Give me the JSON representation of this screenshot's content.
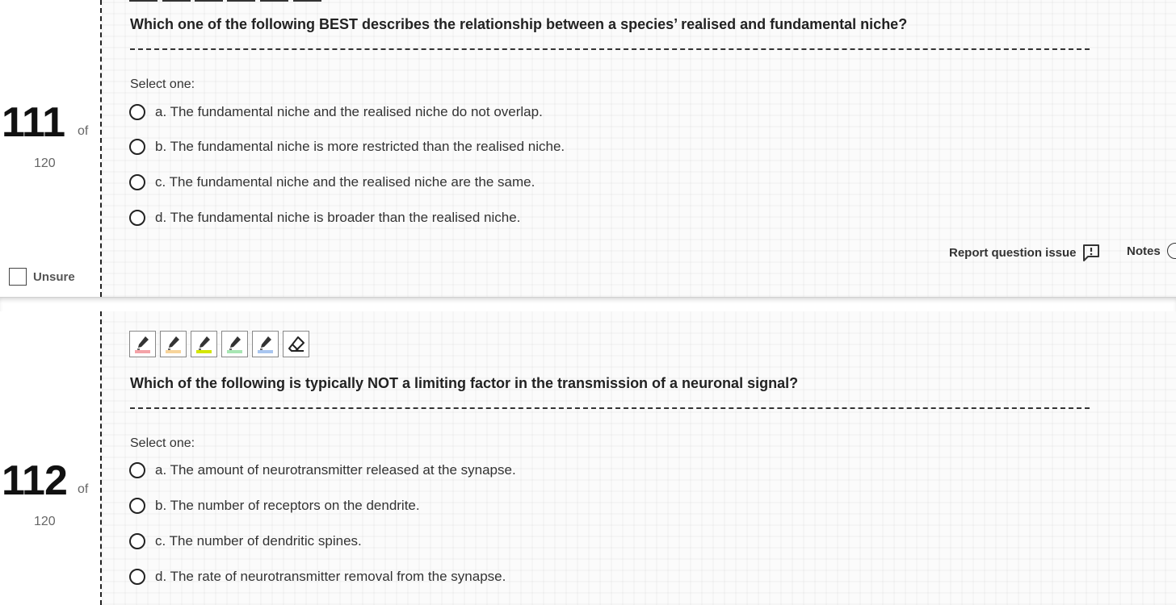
{
  "questions": [
    {
      "number": "111",
      "of_label": "of",
      "total": "120",
      "question": "Which one of the following BEST describes the relationship between a species’ realised and fundamental niche?",
      "select_label": "Select one:",
      "options": [
        "a. The fundamental niche and the realised niche do not overlap.",
        "b. The fundamental niche is more restricted than the realised niche.",
        "c. The fundamental niche and the realised niche are the same.",
        "d. The fundamental niche is broader than the realised niche."
      ],
      "unsure_label": "Unsure",
      "report_label": "Report question issue",
      "notes_label": "Notes"
    },
    {
      "number": "112",
      "of_label": "of",
      "total": "120",
      "question": "Which of the following is typically NOT a limiting factor in the transmission of a neuronal signal?",
      "select_label": "Select one:",
      "options": [
        "a. The amount of neurotransmitter released at the synapse.",
        "b. The number of receptors on the dendrite.",
        "c. The number of dendritic spines.",
        "d. The rate of neurotransmitter removal from the synapse."
      ]
    }
  ],
  "highlighter_tools": [
    {
      "name": "pink-highlighter",
      "color": "#f4a3a8"
    },
    {
      "name": "orange-highlighter",
      "color": "#f7d49a"
    },
    {
      "name": "yellow-highlighter",
      "color": "#d4e600"
    },
    {
      "name": "green-highlighter",
      "color": "#a8e6b4"
    },
    {
      "name": "blue-highlighter",
      "color": "#a9c6f0"
    },
    {
      "name": "eraser",
      "color": "#ffffff"
    }
  ]
}
